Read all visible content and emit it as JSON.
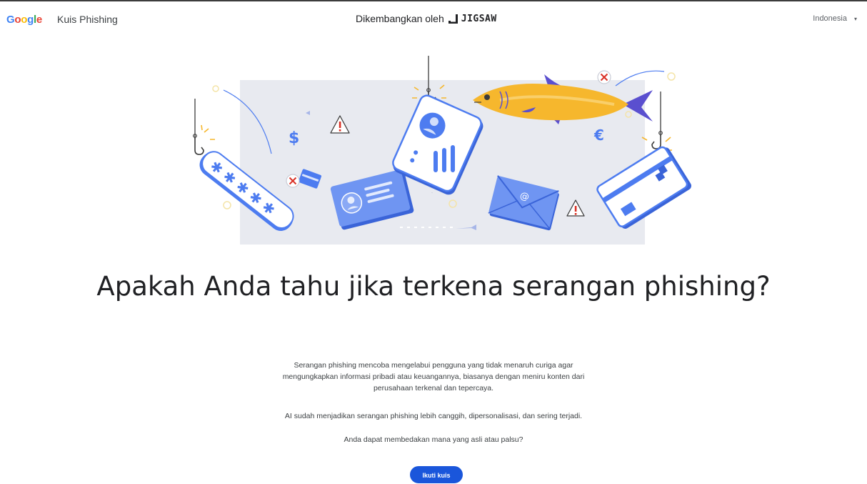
{
  "header": {
    "logo": {
      "G": "G",
      "o1": "o",
      "o2": "o",
      "g": "g",
      "l": "l",
      "e": "e"
    },
    "app_title": "Kuis Phishing",
    "developed_by": "Dikembangkan oleh",
    "partner_name": "JIGSAW",
    "language": "Indonesia",
    "language_caret": "▾"
  },
  "main": {
    "title": "Apakah Anda tahu jika terkena serangan phishing?",
    "paragraph1_line1": "Serangan phishing mencoba mengelabui pengguna yang tidak menaruh curiga agar",
    "paragraph1_line2": "mengungkapkan informasi pribadi atau keuangannya, biasanya dengan meniru konten dari",
    "paragraph1_line3": "perusahaan terkenal dan tepercaya.",
    "paragraph2": "AI sudah menjadikan serangan phishing lebih canggih, dipersonalisasi, dan sering terjadi.",
    "paragraph3": "Anda dapat membedakan mana yang asli atau palsu?",
    "cta_label": "Ikuti kuis"
  },
  "colors": {
    "accent_blue": "#1a56db",
    "illustration_bg": "#e8eaf0",
    "illustration_blue": "#4d7cf0",
    "fish_yellow": "#f6b72d",
    "fish_purple": "#5a4fcf",
    "warning_red": "#d93025"
  },
  "icons": [
    "jigsaw-logo-icon",
    "language-caret-icon",
    "fishing-hook-icon",
    "password-card-icon",
    "id-card-icon",
    "fish-icon",
    "email-envelope-icon",
    "credit-card-icon",
    "warning-icon",
    "dollar-icon",
    "euro-icon",
    "close-x-icon"
  ]
}
